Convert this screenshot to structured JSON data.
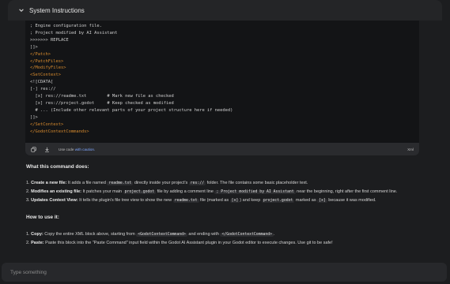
{
  "header": {
    "title": "System Instructions"
  },
  "code": {
    "lines": [
      "; Engine configuration file.",
      "; Project modified by AI Assistant",
      ">>>>>>> REPLACE",
      "]]>",
      "</Patch>",
      "</PatchFiles>",
      "</ModifyFiles>",
      "<SetContext>",
      "<![CDATA[",
      "[-] res://",
      "  [x] res://readme.txt        # Mark new file as checked",
      "  [x] res://project.godot     # Keep checked as modified",
      "  # ... (Include other relevant parts of your project structure here if needed)",
      "]]>",
      "</SetContext>",
      "</GodotContextCommands>"
    ],
    "footer_note_prefix": "Use code",
    "footer_note_link": "with caution.",
    "language": "Xml"
  },
  "explain": {
    "heading": "What this command does:",
    "items": [
      {
        "bold": "Create a new file:",
        "t1": " It adds a file named ",
        "c1": "readme.txt",
        "t2": " directly inside your project's ",
        "c2": "res://",
        "t3": " folder. The file contains some basic placeholder text."
      },
      {
        "bold": "Modifies an existing file:",
        "t1": " It patches your main ",
        "c1": "project.godot",
        "t2": " file by adding a comment line ",
        "c2": "; Project modified by AI Assistant",
        "t3": " near the beginning, right after the first comment line."
      },
      {
        "bold": "Updates Context View:",
        "t1": " It tells the plugin's file tree view to show the new ",
        "c1": "readme.txt",
        "t2": " file (marked as ",
        "c2": "[x]",
        "t3": ") and keep ",
        "c3": "project.godot",
        "t4": " marked as ",
        "c4": "[x]",
        "t5": " because it was modified."
      }
    ]
  },
  "howto": {
    "heading": "How to use it:",
    "items": [
      {
        "bold": "Copy:",
        "t1": " Copy the entire XML block above, starting from ",
        "c1": "<GodotContextCommand>",
        "t2": " and ending with ",
        "c2": "</GodotContextCommand>",
        "t3": "."
      },
      {
        "bold": "Paste:",
        "t1": " Paste this block into the \"Paste Command\" input field within the Godot AI Assistant plugin in your Godot editor to execute changes. Use git to be safe!"
      }
    ]
  },
  "input": {
    "placeholder": "Type something"
  }
}
